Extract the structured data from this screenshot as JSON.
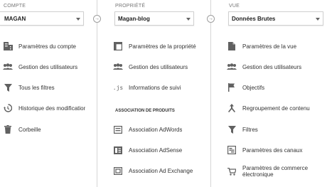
{
  "account": {
    "header": "COMPTE",
    "selected": "MAGAN",
    "items": [
      {
        "label": "Paramètres du compte",
        "icon": "building-icon"
      },
      {
        "label": "Gestion des utilisateurs",
        "icon": "users-icon"
      },
      {
        "label": "Tous les filtres",
        "icon": "filter-icon"
      },
      {
        "label": "Historique des modifications",
        "icon": "history-icon"
      },
      {
        "label": "Corbeille",
        "icon": "trash-icon"
      }
    ]
  },
  "property": {
    "header": "PROPRIÉTÉ",
    "selected": "Magan-blog",
    "items": [
      {
        "label": "Paramètres de la propriété",
        "icon": "window-icon"
      },
      {
        "label": "Gestion des utilisateurs",
        "icon": "users-icon"
      },
      {
        "label": "Informations de suivi",
        "icon": "js-icon"
      }
    ],
    "products_section": "ASSOCIATION DE PRODUITS",
    "products": [
      {
        "label": "Association AdWords",
        "icon": "adwords-icon"
      },
      {
        "label": "Association AdSense",
        "icon": "adsense-icon"
      },
      {
        "label": "Association Ad Exchange",
        "icon": "adexchange-icon"
      }
    ]
  },
  "view": {
    "header": "VUE",
    "selected": "Données Brutes",
    "items": [
      {
        "label": "Paramètres de la vue",
        "icon": "document-icon"
      },
      {
        "label": "Gestion des utilisateurs",
        "icon": "users-icon"
      },
      {
        "label": "Objectifs",
        "icon": "flag-icon"
      },
      {
        "label": "Regroupement de contenu",
        "icon": "merge-icon"
      },
      {
        "label": "Filtres",
        "icon": "filter-icon"
      },
      {
        "label": "Paramètres des canaux",
        "icon": "channels-icon"
      },
      {
        "label": "Paramètres de commerce électronique",
        "icon": "cart-icon"
      }
    ]
  }
}
